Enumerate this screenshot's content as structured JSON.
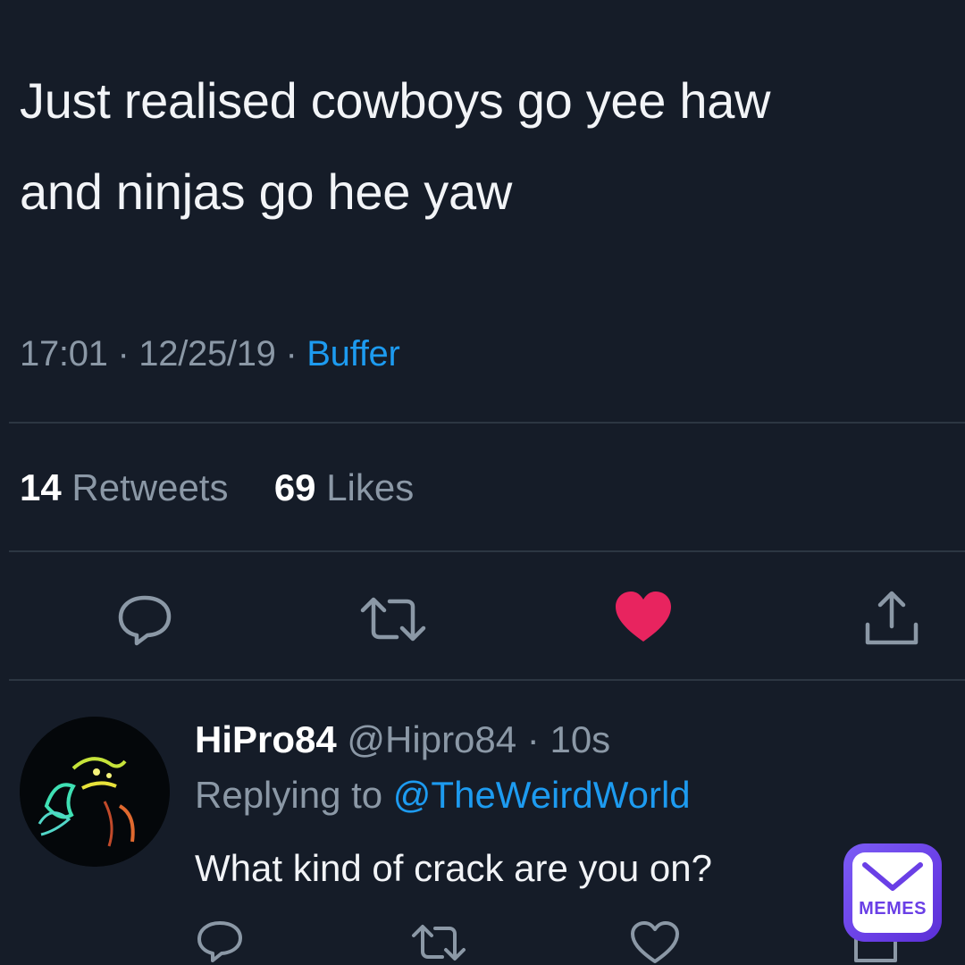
{
  "tweet": {
    "text": "Just realised cowboys go yee haw\nand ninjas go hee yaw",
    "time": "17:01",
    "date": "12/25/19",
    "separator": "·",
    "source": "Buffer",
    "stats": {
      "retweets_count": "14",
      "retweets_label": "Retweets",
      "likes_count": "69",
      "likes_label": "Likes"
    },
    "actions": {
      "reply_icon": "comment-icon",
      "retweet_icon": "retweet-icon",
      "like_icon": "heart-filled-icon",
      "share_icon": "share-icon"
    }
  },
  "reply": {
    "display_name": "HiPro84",
    "handle": "@Hipro84",
    "separator": "·",
    "time": "10s",
    "replying_prefix": "Replying to",
    "replying_to": "@TheWeirdWorld",
    "text": "What kind of crack are you on?"
  },
  "watermark": {
    "label": "MEMES"
  },
  "colors": {
    "background": "#151c28",
    "link": "#1d9bf0",
    "like": "#e8245f",
    "muted": "#8b98a6"
  }
}
